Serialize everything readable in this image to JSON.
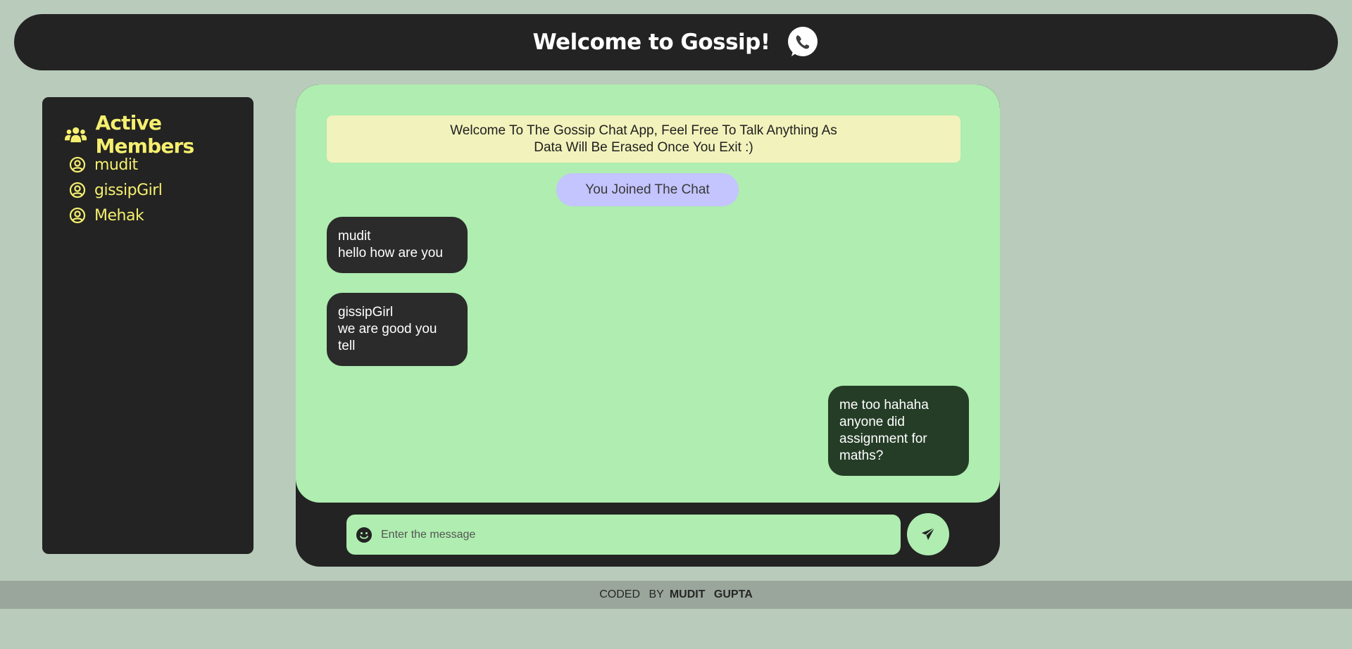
{
  "header": {
    "title": "Welcome to Gossip!",
    "logo_icon": "whatsapp-phone-icon"
  },
  "sidebar": {
    "heading": "Active Members",
    "heading_icon": "users-icon",
    "members": [
      {
        "name": "mudit",
        "icon": "user-circle-icon"
      },
      {
        "name": "gissipGirl",
        "icon": "user-circle-icon"
      },
      {
        "name": "Mehak",
        "icon": "user-circle-icon"
      }
    ]
  },
  "chat": {
    "welcome_banner": "Welcome To The Gossip Chat App, Feel Free To Talk Anything As Data Will Be Erased Once You Exit :)",
    "join_notice": "You Joined The Chat",
    "messages": [
      {
        "sender": "mudit",
        "text": "hello how are you",
        "direction": "incoming"
      },
      {
        "sender": "gissipGirl",
        "text": "we are good you tell",
        "direction": "incoming"
      },
      {
        "sender": "",
        "text": "me too hahaha anyone did assignment for maths?",
        "direction": "outgoing"
      }
    ]
  },
  "composer": {
    "placeholder": "Enter the message",
    "emoji_icon": "smile-icon",
    "send_icon": "paper-plane-icon"
  },
  "footer": {
    "prefix": "CODED BY",
    "author": "MUDIT GUPTA"
  },
  "colors": {
    "page_bg": "#b9cbbb",
    "dark_panel": "#232323",
    "accent_yellow": "#f5ef6f",
    "chat_bg": "#afedb0",
    "banner_bg": "#f2f2bc",
    "join_bg": "#c4c4ff",
    "outgoing_bubble": "#253d27",
    "footer_bg": "#9aa69b"
  }
}
